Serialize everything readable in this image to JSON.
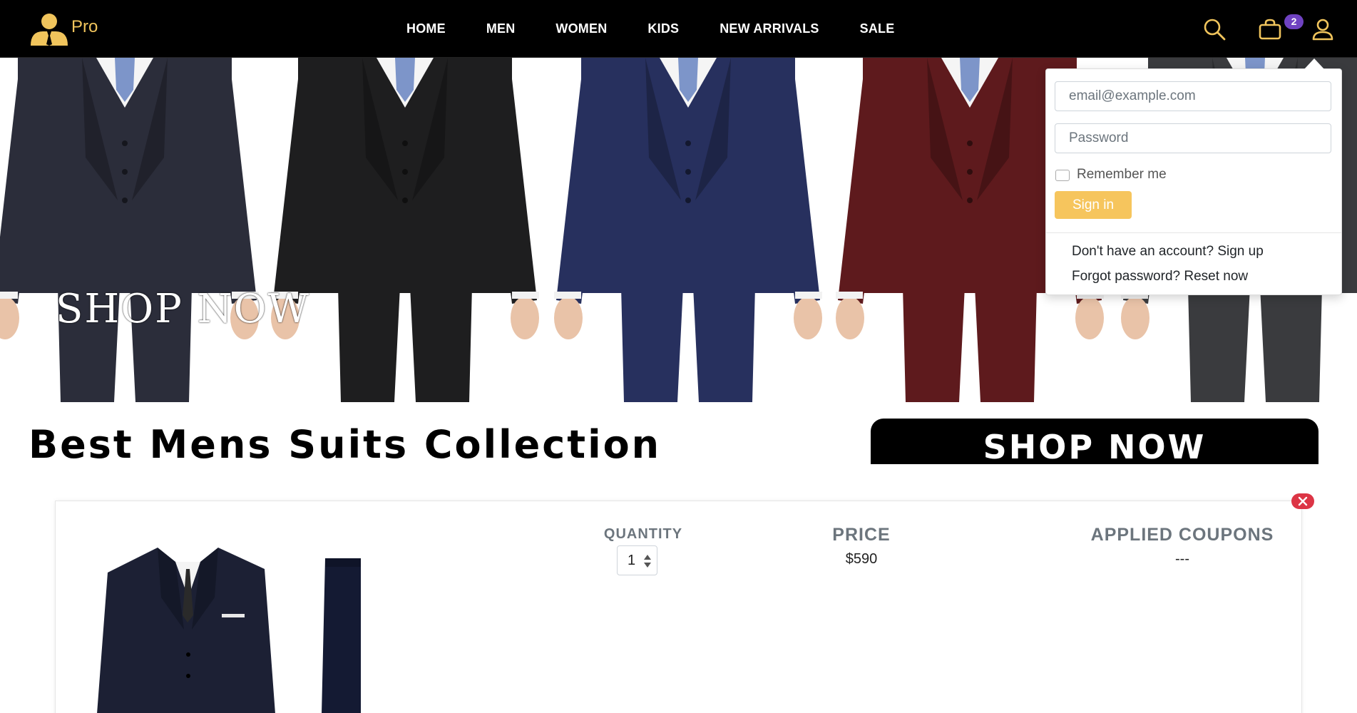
{
  "brand": {
    "name": "Pro",
    "accent": "#f0c45c"
  },
  "nav": {
    "items": [
      "HOME",
      "MEN",
      "WOMEN",
      "KIDS",
      "NEW ARRIVALS",
      "SALE"
    ],
    "icons": [
      "search-icon",
      "bag-icon",
      "user-icon"
    ],
    "cart_count": "2"
  },
  "hero": {
    "cta": "SHOP NOW",
    "suit_colors": [
      "#2b2d3a",
      "#1e1e1f",
      "#27305e",
      "#5e1a1d",
      "#3a3b3e"
    ]
  },
  "banner": {
    "title": "Best Mens Suits Collection",
    "button": "SHOP NOW"
  },
  "cart": {
    "columns": {
      "quantity": "QUANTITY",
      "price": "PRICE",
      "coupons": "APPLIED COUPONS"
    },
    "quantity": "1",
    "price": "$590",
    "coupons": "---"
  },
  "signin": {
    "email_placeholder": "email@example.com",
    "password_placeholder": "Password",
    "remember": "Remember me",
    "submit": "Sign in",
    "signup_link": "Don't have an account? Sign up",
    "reset_link": "Forgot password? Reset now",
    "button_color": "#f6c55d"
  }
}
